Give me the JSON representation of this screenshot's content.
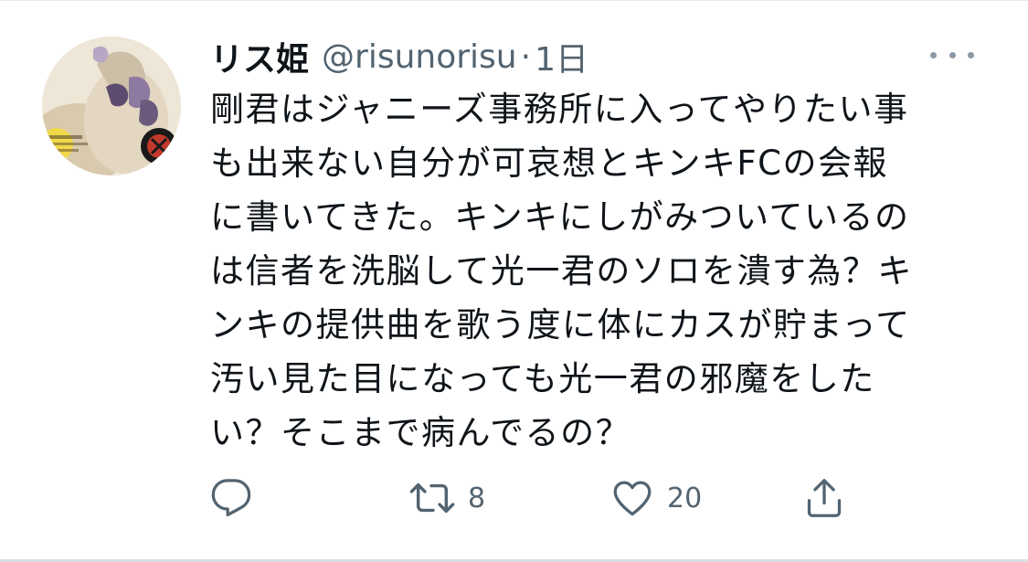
{
  "user": {
    "display_name": "リス姫",
    "handle": "@risunorisu",
    "separator": "·",
    "timestamp": "1日",
    "avatar_icon": "profile-avatar-image"
  },
  "tweet": {
    "lines": [
      "剛君はジャニーズ事務所に入ってやりたい事",
      "も出来ない自分が可哀想とキンキFCの会報",
      "に書いてきた。キンキにしがみついているの",
      "は信者を洗脳して光一君のソロを潰す為？キ",
      "ンキの提供曲を歌う度に体にカスが貯まって",
      "汚い見た目になっても光一君の邪魔をした",
      "い？そこまで病んでるの？"
    ]
  },
  "actions": {
    "reply": {
      "icon": "reply-icon",
      "count": ""
    },
    "retweet": {
      "icon": "retweet-icon",
      "count": "8"
    },
    "like": {
      "icon": "heart-icon",
      "count": "20"
    },
    "share": {
      "icon": "share-icon",
      "count": ""
    }
  },
  "more_icon": "more-options-icon",
  "colors": {
    "text": "#0f1419",
    "secondary": "#536471",
    "divider": "#e6ecf0"
  }
}
